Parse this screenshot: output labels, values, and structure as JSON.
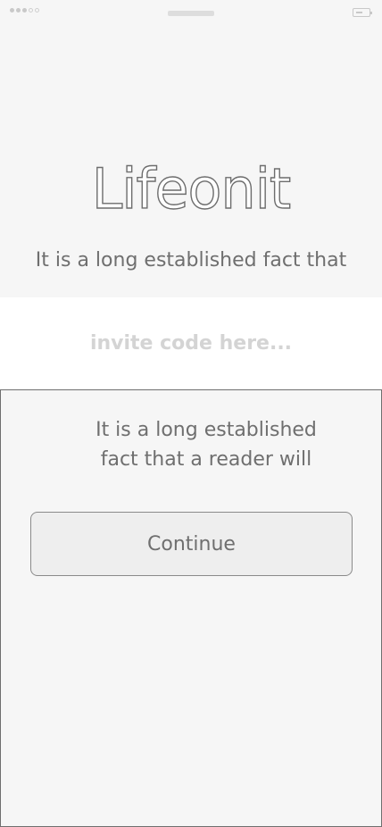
{
  "app": {
    "logo_text": "Lifeonit",
    "tagline": "It is a long established fact that"
  },
  "status_bar": {
    "signal_filled": 3,
    "signal_total": 5
  },
  "invite": {
    "placeholder": "invite code here...",
    "value": ""
  },
  "sheet": {
    "message": "It is a long established fact that a reader will",
    "continue_label": "Continue"
  },
  "colors": {
    "background": "#f6f6f6",
    "text": "#6f6f6f",
    "placeholder": "#d4d4d4",
    "button_bg": "#eeeeee",
    "border": "#6f6f6f"
  }
}
